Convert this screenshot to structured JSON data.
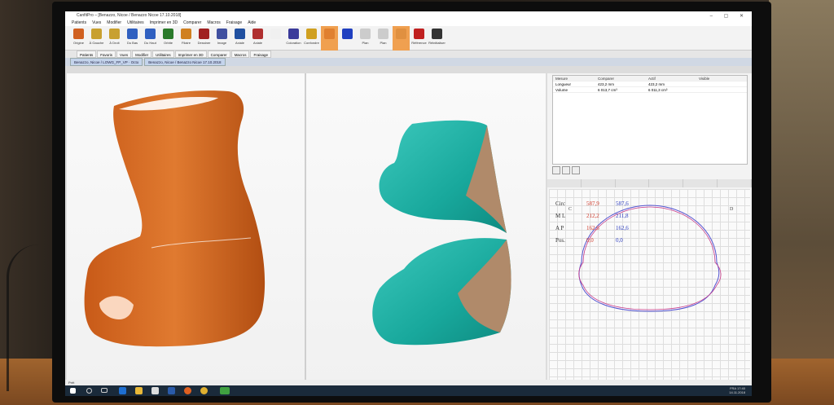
{
  "window": {
    "title": "CanfitPro – [Benazzo, Nicoe / Benazzo Nicoe 17.10.2018]",
    "controls": "–  ▢  ✕"
  },
  "menu": [
    "Patients",
    "Vues",
    "Modifier",
    "Utilitaires",
    "Imprimer en 3D",
    "Comparer",
    "Macros",
    "Fraisage",
    "Aide"
  ],
  "toolbar": [
    {
      "label": "Origine",
      "color": "#d06020"
    },
    {
      "label": "À Gauche",
      "color": "#c8a030"
    },
    {
      "label": "À Droit",
      "color": "#c8a030"
    },
    {
      "label": "Du Bas",
      "color": "#3060c0"
    },
    {
      "label": "Du Haut",
      "color": "#3060c0"
    },
    {
      "label": "Orbite",
      "color": "#2a7a2a"
    },
    {
      "label": "Filaire",
      "color": "#d08020"
    },
    {
      "label": "Dessiner",
      "color": "#a02020"
    },
    {
      "label": "Image",
      "color": "#4050a0"
    },
    {
      "label": "Axiale",
      "color": "#2050a0"
    },
    {
      "label": "Axiale",
      "color": "#b03030"
    },
    {
      "label": "",
      "color": "#f0f0f0"
    },
    {
      "label": "Coloration",
      "color": "#3a3a9a"
    },
    {
      "label": "Confondre",
      "color": "#d0a020"
    },
    {
      "label": "",
      "color": "#e08030"
    },
    {
      "label": "",
      "color": "#2040c0"
    },
    {
      "label": "Plan",
      "color": "#cccccc"
    },
    {
      "label": "Plan",
      "color": "#cccccc"
    },
    {
      "label": "",
      "color": "#e09040"
    },
    {
      "label": "Référence",
      "color": "#c02020"
    },
    {
      "label": "Réinitialiser",
      "color": "#333333"
    }
  ],
  "ribbon_tabs": [
    "Patients",
    "Favoris",
    "Vues",
    "Modifier",
    "Utilitaires",
    "Imprimer en 3D",
    "Comparer",
    "Macros",
    "Fraisage"
  ],
  "doc_tabs": [
    "Benazzo, Nicoe / LOWG_FP_VP · Octo",
    "Benazzo, Nicoe / Benazzo Nicoe 17.10.2018"
  ],
  "measures_table": {
    "headers": [
      "Mesure",
      "Comparer",
      "Actif",
      "Visible"
    ],
    "rows": [
      [
        "Longueur",
        "423,2 mm",
        "423,2 mm",
        ""
      ],
      [
        "Volume",
        "6 013,7 cm³",
        "6 011,3 cm³",
        ""
      ]
    ]
  },
  "graph_labels": {
    "left": "C",
    "right": "D"
  },
  "section_measures": [
    {
      "label": "Circ",
      "v1": "587,9",
      "v2": "587,6"
    },
    {
      "label": "M L",
      "v1": "212,2",
      "v2": "211,8"
    },
    {
      "label": "A P",
      "v1": "162,6",
      "v2": "162,6"
    },
    {
      "label": "Pos.",
      "v1": "0,0",
      "v2": "0,0"
    }
  ],
  "status_text": "Prêt",
  "tray": {
    "lang": "FRA",
    "time": "17:40",
    "date": "14.11.2018"
  },
  "colors": {
    "model_orange": "#d06a22",
    "model_teal": "#1fb0a4",
    "profile_red": "#c83a8a",
    "profile_blue": "#5050d0"
  }
}
